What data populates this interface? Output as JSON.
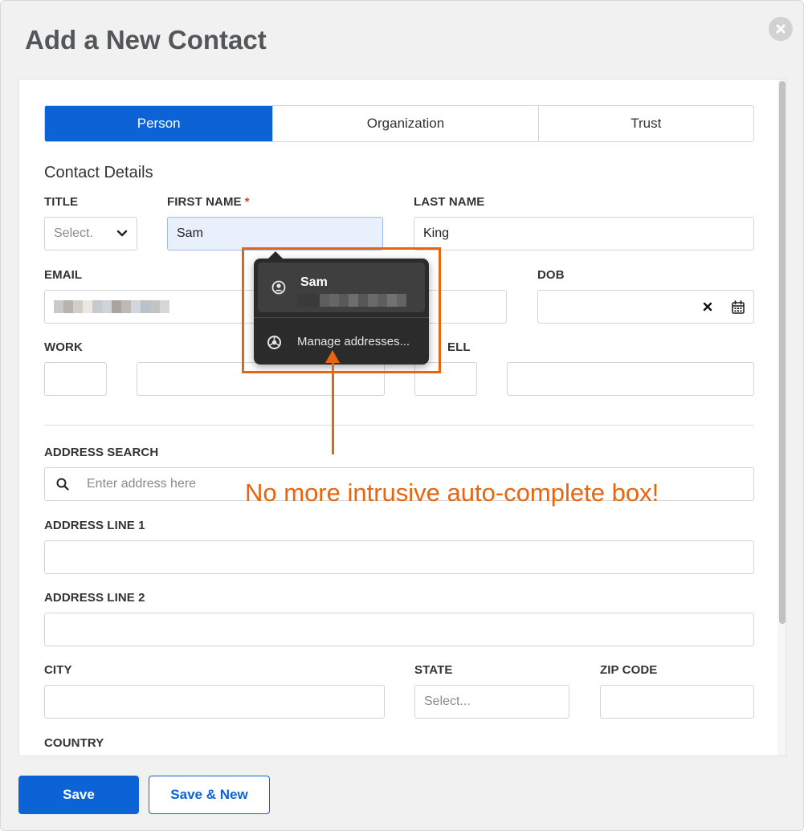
{
  "dialog": {
    "title": "Add a New Contact"
  },
  "tabs": [
    {
      "label": "Person",
      "active": true
    },
    {
      "label": "Organization",
      "active": false
    },
    {
      "label": "Trust",
      "active": false
    }
  ],
  "section_title": "Contact Details",
  "fields": {
    "title": {
      "label": "TITLE",
      "placeholder": "Select."
    },
    "first_name": {
      "label": "FIRST NAME",
      "required_mark": "*",
      "value": "Sam"
    },
    "last_name": {
      "label": "LAST NAME",
      "value": "King"
    },
    "email": {
      "label": "EMAIL"
    },
    "dob": {
      "label": "DOB"
    },
    "work": {
      "label": "WORK"
    },
    "cell": {
      "label": "ELL"
    },
    "address_search": {
      "label": "ADDRESS SEARCH",
      "placeholder": "Enter address here"
    },
    "address_line_1": {
      "label": "ADDRESS LINE 1"
    },
    "address_line_2": {
      "label": "ADDRESS LINE 2"
    },
    "city": {
      "label": "CITY"
    },
    "state": {
      "label": "STATE",
      "placeholder": "Select..."
    },
    "zip": {
      "label": "ZIP CODE"
    },
    "country": {
      "label": "COUNTRY"
    }
  },
  "autofill": {
    "suggestion_name": "Sam",
    "manage_label": "Manage addresses..."
  },
  "annotation": "No more intrusive auto-complete box!",
  "footer": {
    "save_label": "Save",
    "save_new_label": "Save & New"
  },
  "colors": {
    "primary": "#0b63d6",
    "annotation": "#e8650f",
    "required": "#e0412c"
  }
}
